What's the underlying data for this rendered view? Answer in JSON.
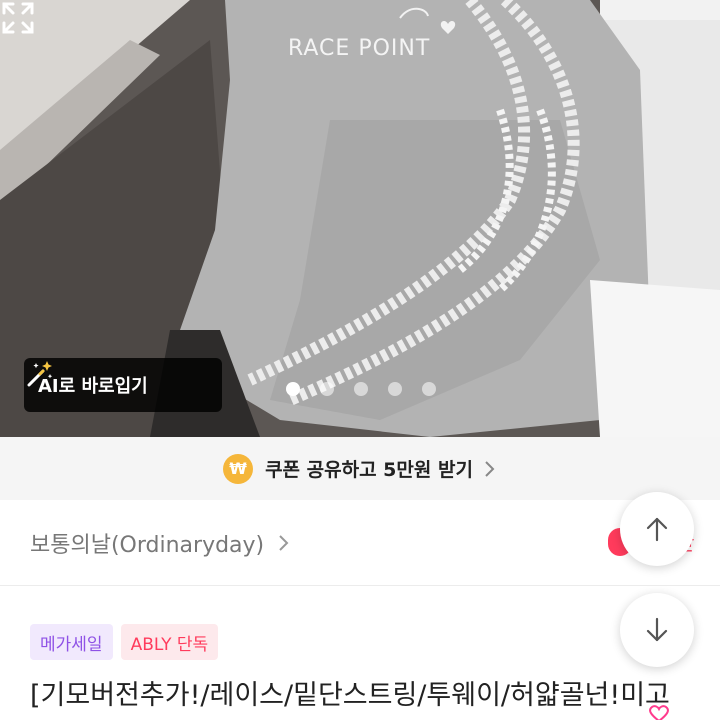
{
  "hero": {
    "print_text": "RACE POINT",
    "ai_button_label": "AI로 바로입기",
    "carousel": {
      "total": 5,
      "active": 1
    }
  },
  "coupon": {
    "icon": "won-coin-icon",
    "icon_glyph": "₩",
    "text": "쿠폰 공유하고 5만원 받기"
  },
  "store": {
    "name": "보통의날(Ordinaryday)",
    "like_partial": "만"
  },
  "tags": [
    {
      "label": "메가세일"
    },
    {
      "label": "ABLY 단독"
    }
  ],
  "product": {
    "title": "[기모버전추가!/레이스/밑단스트링/투웨이/허얇골넌!미고"
  },
  "colors": {
    "accent": "#ff3b5c",
    "mega_tag": "#8f52e6",
    "coupon_coin": "#f5b63a"
  }
}
